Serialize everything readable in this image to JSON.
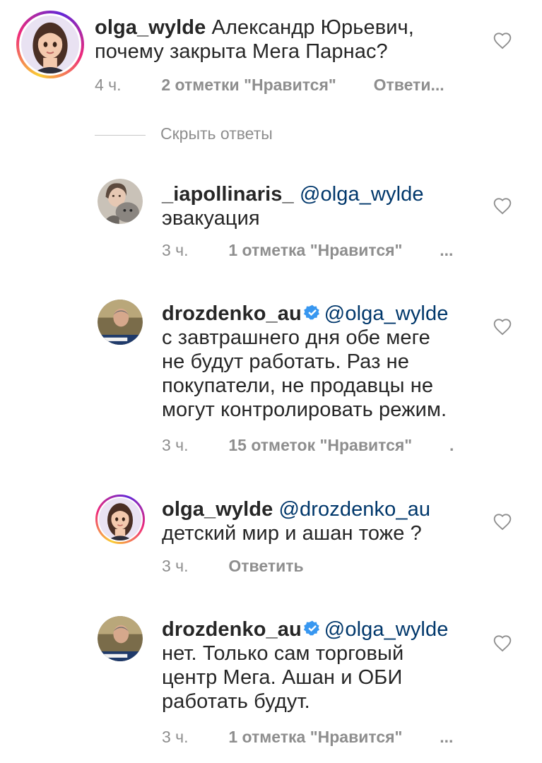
{
  "comments": [
    {
      "username": "olga_wylde",
      "mention": "",
      "text_lines": [
        "Александр Юрьевич,",
        "почему закрыта Мега Парнас?"
      ],
      "time": "4 ч.",
      "likes": "2 отметки \"Нравится\"",
      "reply": "Ответи...",
      "more": ""
    },
    {
      "username": "_iapollinaris_",
      "mention": "@olga_wylde",
      "text_lines": [
        "эвакуация"
      ],
      "time": "3 ч.",
      "likes": "1 отметка \"Нравится\"",
      "reply": "",
      "more": "..."
    },
    {
      "username": "drozdenko_au",
      "mention": "@olga_wylde",
      "text_lines": [
        "с завтрашнего дня обе меге",
        "не будут работать. Раз не",
        "покупатели, не продавцы не",
        "могут контролировать режим."
      ],
      "time": "3 ч.",
      "likes": "15 отметок \"Нравится\"",
      "reply": "",
      "more": "."
    },
    {
      "username": "olga_wylde",
      "mention": "@drozdenko_au",
      "text_lines": [
        "детский мир и ашан тоже ?"
      ],
      "time": "3 ч.",
      "likes": "",
      "reply": "Ответить",
      "more": ""
    },
    {
      "username": "drozdenko_au",
      "mention": "@olga_wylde",
      "text_lines": [
        "нет. Только сам торговый",
        "центр Мега. Ашан и ОБИ",
        "работать будут."
      ],
      "time": "3 ч.",
      "likes": "1 отметка \"Нравится\"",
      "reply": "",
      "more": "..."
    }
  ],
  "hide_replies_label": "Скрыть ответы",
  "icons": {
    "like": "heart-outline-icon",
    "verified": "verified-badge-icon"
  },
  "colors": {
    "text": "#262626",
    "meta": "#8e8e8e",
    "mention": "#00376b",
    "verified": "#3897f0"
  }
}
